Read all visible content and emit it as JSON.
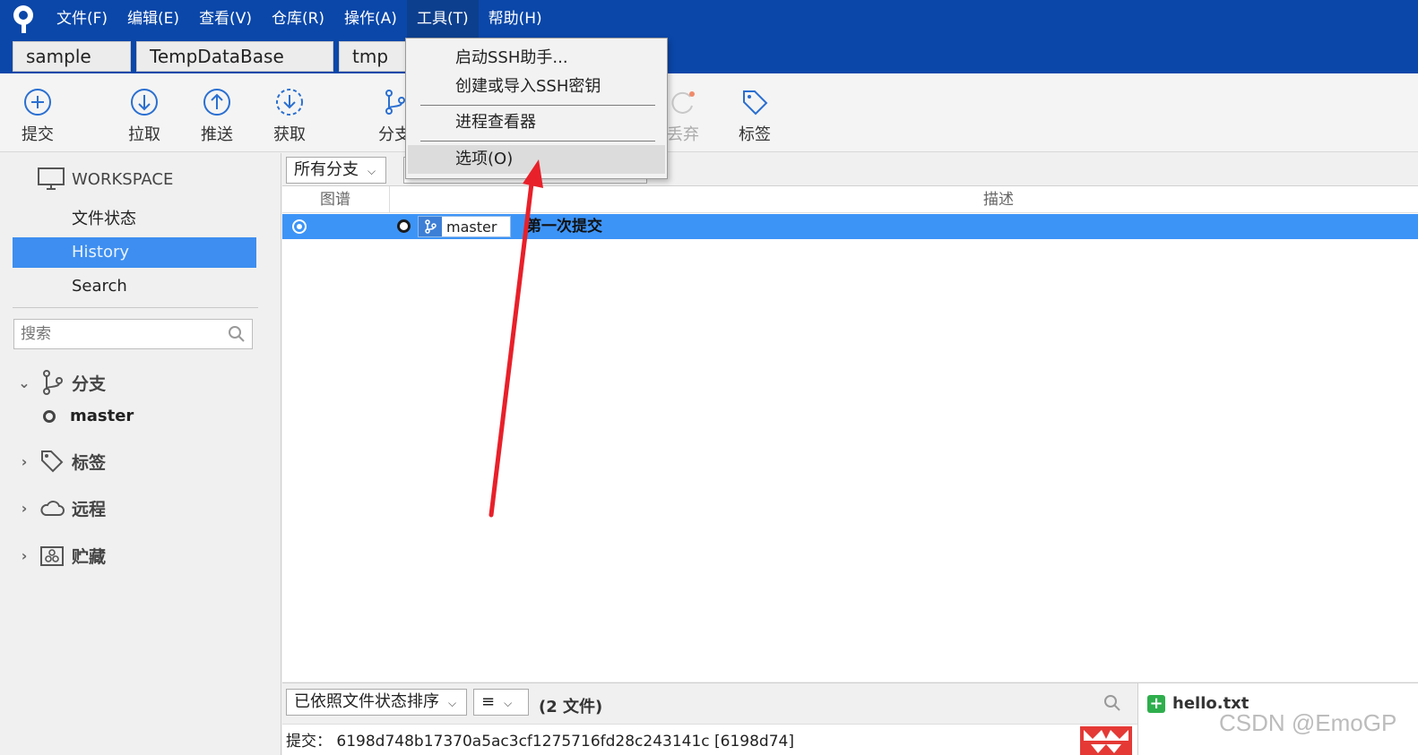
{
  "menu": [
    "文件(F)",
    "编辑(E)",
    "查看(V)",
    "仓库(R)",
    "操作(A)",
    "工具(T)",
    "帮助(H)"
  ],
  "tabs": [
    "sample",
    "TempDataBase",
    "tmp"
  ],
  "toolbar": {
    "commit": "提交",
    "pull": "拉取",
    "push": "推送",
    "fetch": "获取",
    "branch": "分支",
    "discard": "丢弃",
    "tag": "标签"
  },
  "tools_menu": {
    "ssh_agent": "启动SSH助手...",
    "ssh_key": "创建或导入SSH密钥",
    "process_viewer": "进程查看器",
    "options": "选项(O)"
  },
  "sidebar": {
    "workspace": "WORKSPACE",
    "file_status": "文件状态",
    "history": "History",
    "search": "Search",
    "search_placeholder": "搜索",
    "branches": "分支",
    "branch_master": "master",
    "tags": "标签",
    "remotes": "远程",
    "stashes": "贮藏"
  },
  "main": {
    "branch_filter": "所有分支",
    "col_graph": "图谱",
    "col_desc": "描述",
    "commit_branch": "master",
    "commit_msg": "第一次提交"
  },
  "bottom": {
    "sort": "已依照文件状态排序",
    "view_icon": "≡",
    "file_count": "(2 文件)",
    "file_name": "hello.txt",
    "commit_line": "提交： 6198d748b17370a5ac3cf1275716fd28c243141c [6198d74]"
  },
  "watermark": "CSDN @EmoGP",
  "colors": {
    "titlebar": "#0a47a9",
    "selection": "#3d8ef0",
    "arrow": "#e8202a"
  }
}
